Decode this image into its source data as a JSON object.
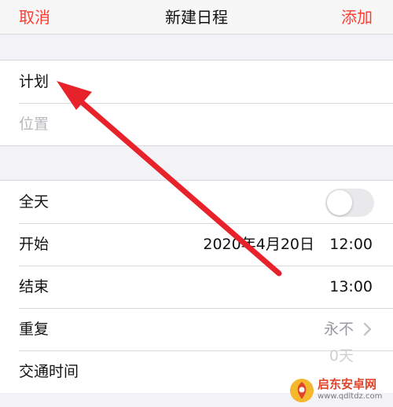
{
  "nav": {
    "cancel_label": "取消",
    "title": "新建日程",
    "add_label": "添加"
  },
  "title_group": {
    "title_value": "计划",
    "location_placeholder": "位置"
  },
  "time_group": {
    "all_day_label": "全天",
    "all_day_on": false,
    "start_label": "开始",
    "start_date": "2020年4月20日",
    "start_time": "12:00",
    "end_label": "结束",
    "end_time": "13:00",
    "repeat_label": "重复",
    "repeat_value": "永不",
    "travel_label": "交通时间",
    "travel_value": "0天"
  },
  "watermark": {
    "name": "启东安卓网",
    "url": "www.qdltdz.com"
  },
  "colors": {
    "accent": "#ff3b30",
    "annotation_arrow": "#e8222a",
    "toggle_off": "#e9e9eb"
  },
  "icons": {
    "chevron": "chevron-right-icon",
    "annotation": "red-arrow-icon",
    "logo": "watermark-logo-icon"
  }
}
